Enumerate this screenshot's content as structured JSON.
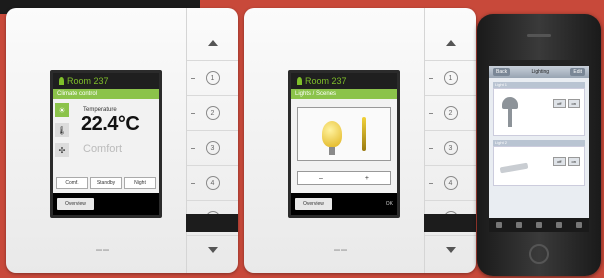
{
  "panels": [
    {
      "room_title": "Room 237",
      "subtitle": "Climate control",
      "temp_label": "Temperature",
      "temperature": "22.4°C",
      "mode": "Comfort",
      "options": [
        "Comf.",
        "Standby",
        "Night"
      ],
      "footer_button": "Overview"
    },
    {
      "room_title": "Room 237",
      "subtitle": "Lights / Scenes",
      "controls": [
        "–",
        "+"
      ],
      "footer_button": "Overview",
      "footer_right": "OK"
    }
  ],
  "phone": {
    "nav_left": "Back",
    "nav_title": "Lighting",
    "nav_right": "Edit",
    "section1": "Light 1",
    "section2": "Light 2",
    "btn_on": "on",
    "btn_off": "off"
  },
  "colors": {
    "background": "#c8493a",
    "accent": "#8bc34a"
  }
}
